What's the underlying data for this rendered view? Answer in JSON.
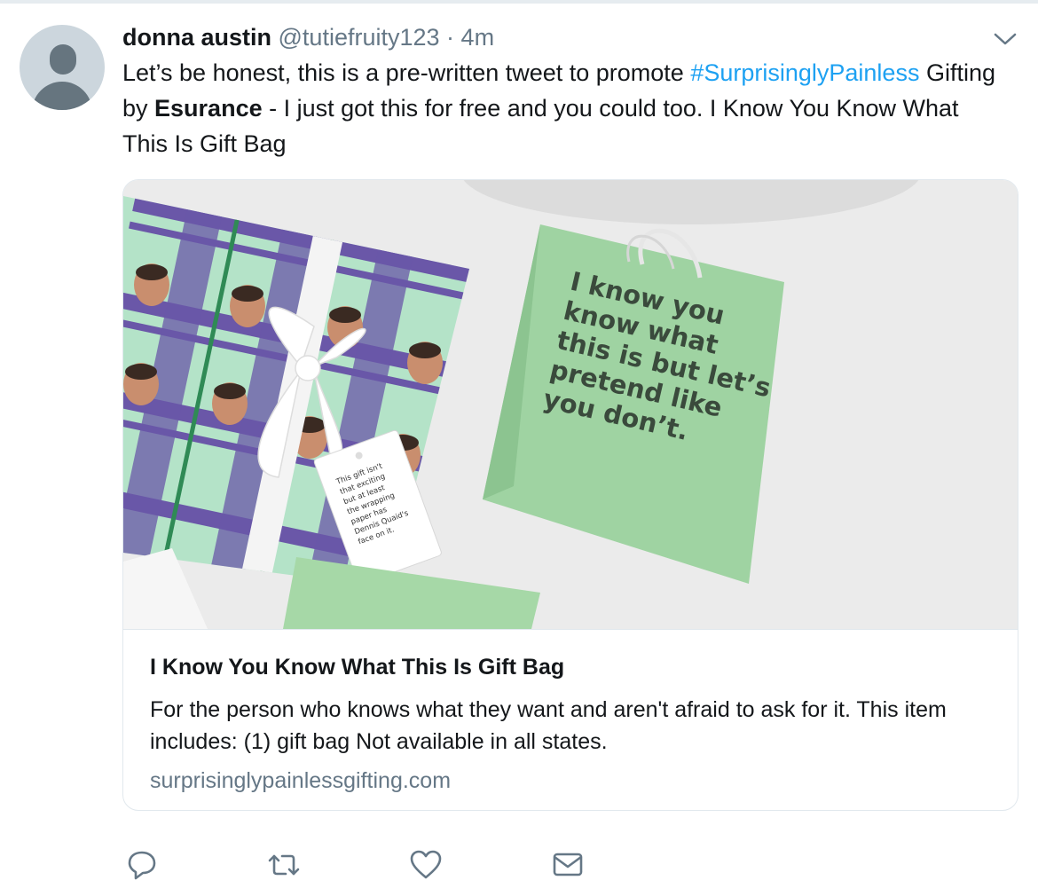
{
  "tweet": {
    "author_name": "donna austin",
    "handle": "@tutiefruity123",
    "separator": "·",
    "time": "4m",
    "text_part1": "Let’s be honest, this is a pre-written tweet to promote ",
    "hashtag": "#SurprisinglyPainless",
    "text_part2": " Gifting by ",
    "brand": "Esurance",
    "text_part3": "  - I just got this for free and you could too.  I Know You Know What This Is Gift Bag"
  },
  "card": {
    "title": "I Know You Know What This Is Gift Bag",
    "description": "For the person who knows what they want and aren't afraid to ask for it. This item includes: (1) gift bag Not available in all states.",
    "url": "surprisinglypainlessgifting.com",
    "image": {
      "bag_lines": [
        "I know you",
        "know what",
        "this is but let’s",
        "pretend like",
        "you don’t."
      ],
      "tag_lines": [
        "This gift isn't",
        "that exciting",
        "but at least",
        "the wrapping",
        "paper has",
        "Dennis Quaid's",
        "face on it."
      ]
    }
  },
  "actions": {
    "reply_icon": "speech-bubble",
    "retweet_icon": "retweet-arrows",
    "like_icon": "heart",
    "dm_icon": "envelope"
  },
  "colors": {
    "link": "#1da1f2",
    "secondary_text": "#657786",
    "bag_green": "#a6d8a7"
  }
}
